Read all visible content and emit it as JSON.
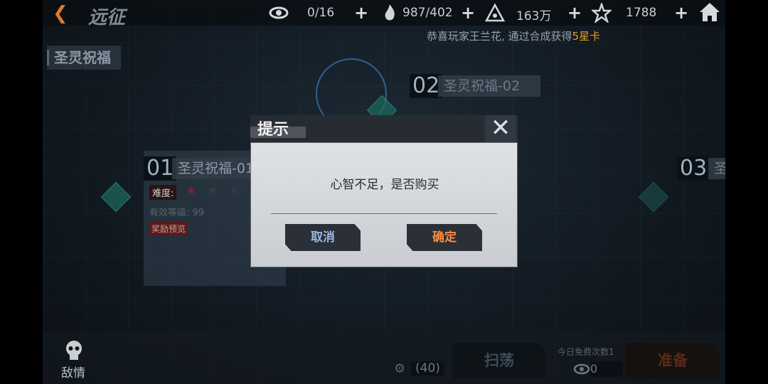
{
  "header": {
    "back_icon": "back-arrow-icon",
    "title": "远征",
    "resources": [
      {
        "icon": "eye-icon",
        "value": "0/16"
      },
      {
        "icon": "flame-icon",
        "value": "987/402"
      },
      {
        "icon": "triangle-emblem-icon",
        "value": "163万"
      },
      {
        "icon": "star-emblem-icon",
        "value": "1788"
      }
    ],
    "home_icon": "home-icon"
  },
  "notice": {
    "prefix": "恭喜玩家王兰花, 通过合成获得",
    "highlight": "5星卡"
  },
  "section_label": "圣灵祝福",
  "nodes": [
    {
      "num": "01",
      "name": "圣灵祝福-01",
      "difficulty_label": "难度:",
      "level_label": "有效等级: 99",
      "reward_label": "奖励预览"
    },
    {
      "num": "02",
      "name": "圣灵祝福-02"
    },
    {
      "num": "03",
      "name": "圣"
    }
  ],
  "dialog": {
    "title": "提示",
    "close_icon": "close-x-icon",
    "message": "心智不足，是否购买",
    "cancel": "取消",
    "confirm": "确定"
  },
  "bottom": {
    "enemy_label": "敌情",
    "sweep_count": "(40)",
    "sweep_label": "扫荡",
    "free_label": "今日免费次数1",
    "free_value": "0",
    "prepare_label": "准备"
  },
  "colors": {
    "accent": "#ff8a3a",
    "highlight": "#e0a021",
    "cancel": "#9ab6e0"
  }
}
